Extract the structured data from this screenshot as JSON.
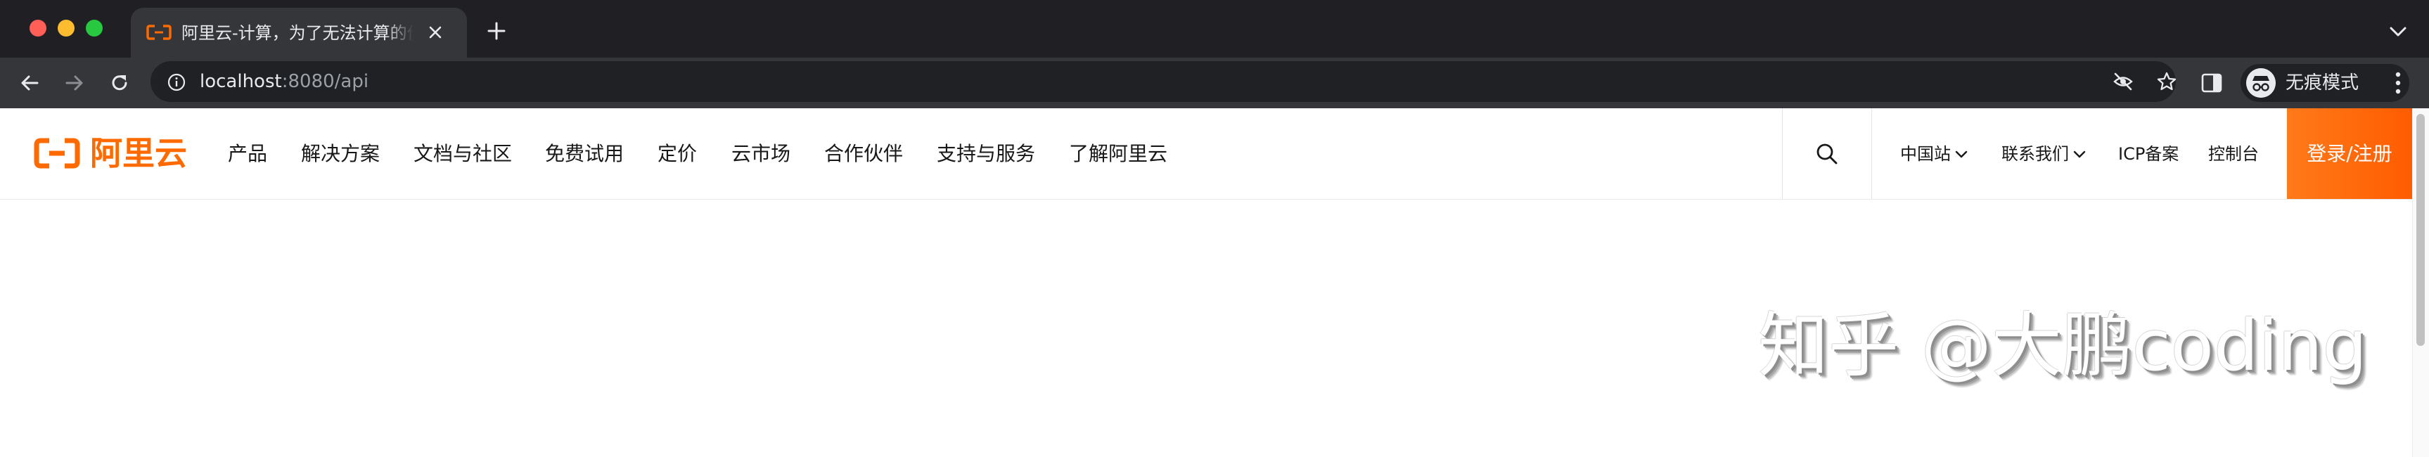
{
  "browser": {
    "tab": {
      "title": "阿里云-计算，为了无法计算的价值"
    },
    "url": {
      "host": "localhost",
      "rest": ":8080/api"
    },
    "profile_label": "无痕模式"
  },
  "site": {
    "logo_text": "阿里云",
    "nav": [
      "产品",
      "解决方案",
      "文档与社区",
      "免费试用",
      "定价",
      "云市场",
      "合作伙伴",
      "支持与服务",
      "了解阿里云"
    ],
    "right": {
      "region": "中国站",
      "contact": "联系我们",
      "icp": "ICP备案",
      "console": "控制台"
    },
    "login_label": "登录/注册",
    "brand_color": "#ff6a00"
  },
  "watermark": "知乎 @大鹏coding",
  "icons": [
    "aliyun-logo-icon",
    "close-icon",
    "plus-icon",
    "chevron-down-icon",
    "back-arrow-icon",
    "forward-arrow-icon",
    "reload-icon",
    "info-icon",
    "eye-off-icon",
    "star-icon",
    "side-panel-icon",
    "incognito-icon",
    "more-vert-icon",
    "search-icon"
  ]
}
